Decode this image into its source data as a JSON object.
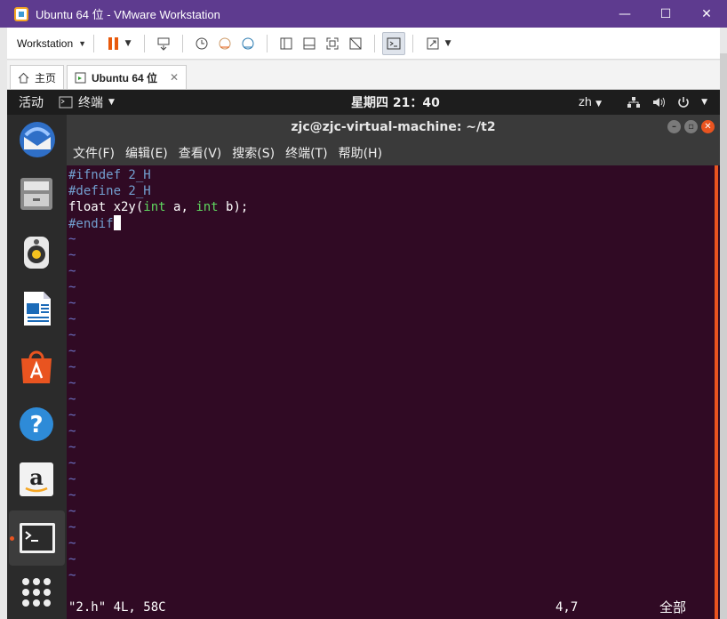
{
  "window": {
    "title": "Ubuntu 64 位 - VMware Workstation",
    "minimize": "—",
    "maximize": "☐",
    "close": "✕"
  },
  "toolbar": {
    "workstation_label": "Workstation"
  },
  "tabs": [
    {
      "label": "主页"
    },
    {
      "label": "Ubuntu 64 位"
    }
  ],
  "ubuntu_topbar": {
    "activities": "活动",
    "app_menu": "终端",
    "clock": "星期四 21：40",
    "input_method": "zh"
  },
  "terminal": {
    "title": "zjc@zjc-virtual-machine: ~/t2",
    "menu": [
      "文件(F)",
      "编辑(E)",
      "查看(V)",
      "搜索(S)",
      "终端(T)",
      "帮助(H)"
    ],
    "code_lines": [
      {
        "parts": [
          {
            "t": "#ifndef 2_H",
            "c": "pp"
          }
        ]
      },
      {
        "parts": [
          {
            "t": "#define 2_H",
            "c": "pp"
          }
        ]
      },
      {
        "parts": [
          {
            "t": "float x2y(",
            "c": "tx"
          },
          {
            "t": "int",
            "c": "kw"
          },
          {
            "t": " a, ",
            "c": "tx"
          },
          {
            "t": "int",
            "c": "kw"
          },
          {
            "t": " b);",
            "c": "tx"
          }
        ]
      },
      {
        "parts": [
          {
            "t": "#endif",
            "c": "pp"
          }
        ]
      }
    ],
    "tilde_char": "~",
    "tilde_count": 22,
    "status_file": "\"2.h\" 4L, 58C",
    "status_position": "4,7",
    "status_scroll": "全部"
  },
  "colors": {
    "vmware_titlebar": "#5e3b8f",
    "terminal_bg": "#300a24",
    "ubuntu_orange": "#e95420",
    "preprocessor": "#729fcf",
    "keyword": "#5fd75f",
    "tilde": "#6c71c4"
  }
}
